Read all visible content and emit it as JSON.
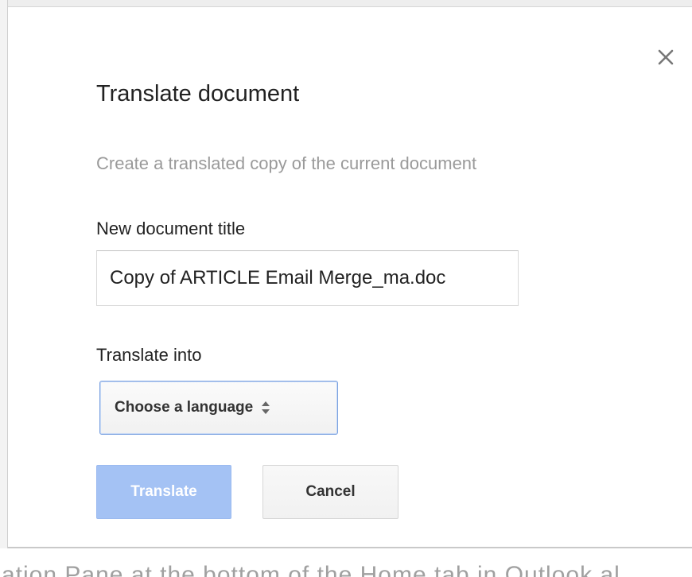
{
  "dialog": {
    "title": "Translate document",
    "subtitle": "Create a translated copy of the current document",
    "close_icon": "close-icon",
    "new_title_label": "New document title",
    "new_title_value": "Copy of ARTICLE Email Merge_ma.doc",
    "translate_into_label": "Translate into",
    "language_select": {
      "selected": "Choose a language",
      "icon": "up-down-arrows-icon"
    },
    "buttons": {
      "translate": "Translate",
      "cancel": "Cancel"
    },
    "colors": {
      "translate_button_disabled": "#a4c2f4",
      "select_focus_border": "#7aa1e0",
      "subtitle_text": "#9a9a9a"
    }
  },
  "background": {
    "partial_text": "ation Pane at the bottom of the Home tab in Outlook al"
  }
}
